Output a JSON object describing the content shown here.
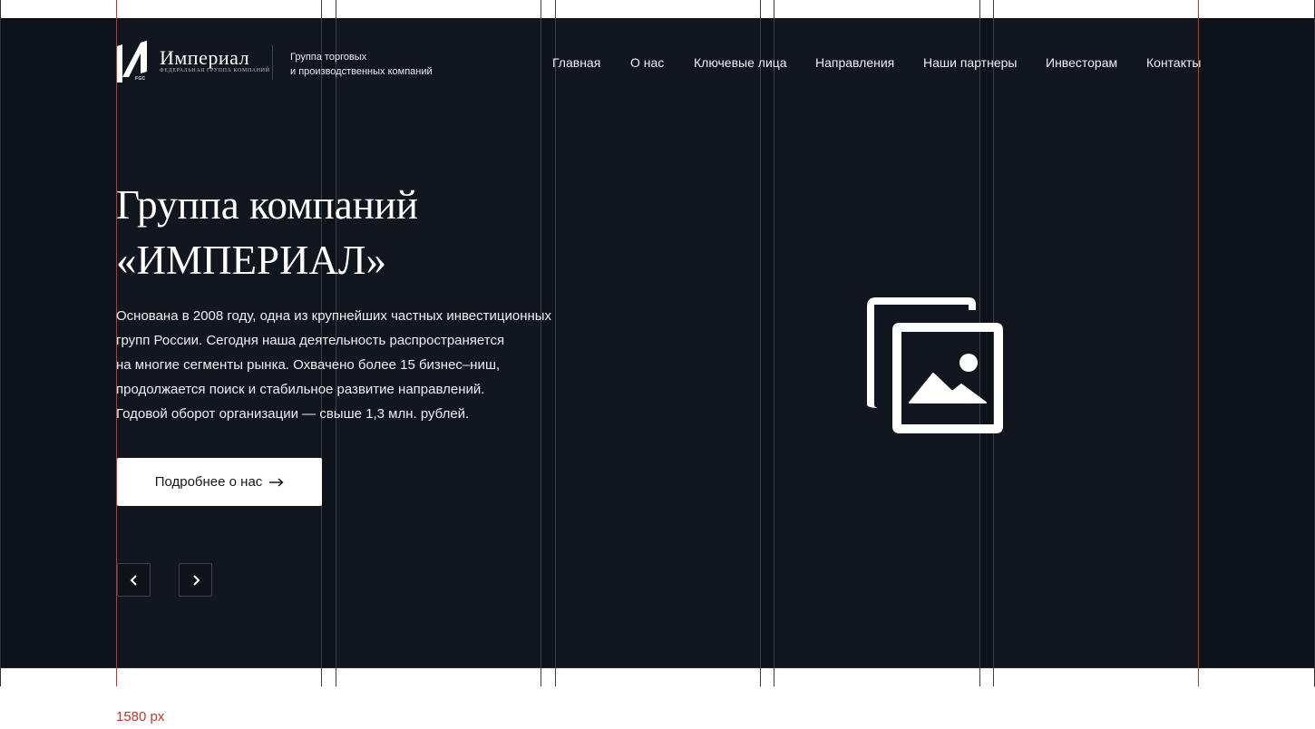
{
  "header": {
    "logo_word": "Империал",
    "logo_sub": "ФЕДЕРАЛЬНАЯ ГРУППА КОМПАНИЙ",
    "logo_abbr": "FGC",
    "tagline_line1": "Группа торговых",
    "tagline_line2": "и производственных компаний"
  },
  "nav": {
    "items": [
      {
        "label": "Главная"
      },
      {
        "label": "О нас"
      },
      {
        "label": "Ключевые лица"
      },
      {
        "label": "Направления"
      },
      {
        "label": "Наши партнеры"
      },
      {
        "label": "Инвесторам"
      },
      {
        "label": "Контакты"
      }
    ]
  },
  "hero": {
    "title_line1": "Группа компаний",
    "title_line2": "«ИМПЕРИАЛ»",
    "text_lines": [
      "Основана в 2008 году, одна из крупнейших частных инвестиционных",
      "групп России. Сегодня наша деятельность распространяется",
      "на многие сегменты рынка. Охвачено более 15 бизнес–ниш,",
      "продолжается поиск и стабильное развитие направлений.",
      "Годовой оборот организации — свыше 1,3 млн. рублей."
    ],
    "cta_label": "Подробнее о нас",
    "cta_icon": "arrow-right-icon",
    "image_icon": "image-gallery-icon"
  },
  "carousel": {
    "prev_icon": "chevron-left-icon",
    "next_icon": "chevron-right-icon"
  },
  "layout_note": "1580 px",
  "colors": {
    "hero_background": "#12171f",
    "guide_red": "#c6332c",
    "text_light": "#ffffff"
  }
}
